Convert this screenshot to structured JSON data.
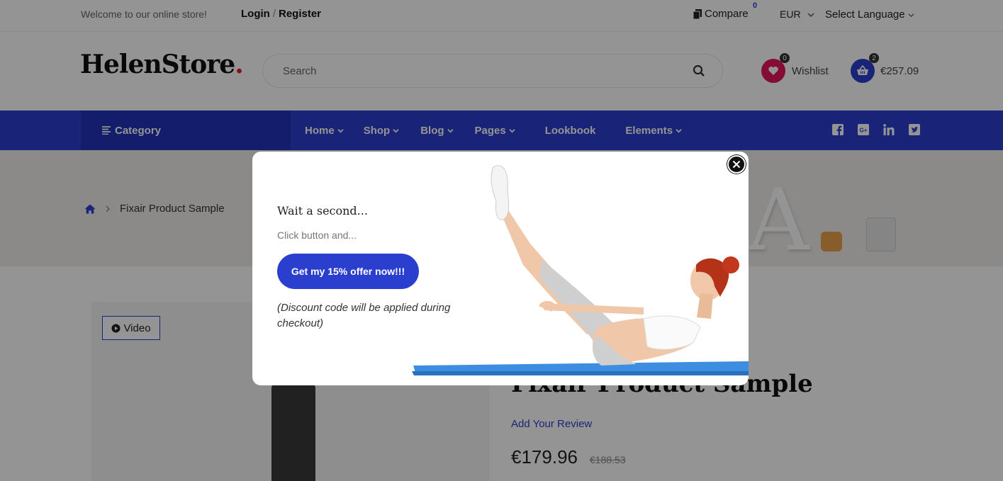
{
  "topbar": {
    "welcome": "Welcome to our online store!",
    "login": "Login",
    "separator": "/",
    "register": "Register",
    "compare_label": "Compare",
    "compare_count": "0",
    "currency": "EUR",
    "language": "Select Language"
  },
  "header": {
    "logo": "HelenStore",
    "logo_dot": ".",
    "search_placeholder": "Search",
    "wishlist_label": "Wishlist",
    "wishlist_count": "0",
    "cart_total": "€257.09",
    "cart_count": "2"
  },
  "nav": {
    "category": "Category",
    "items": [
      {
        "label": "Home",
        "dropdown": true
      },
      {
        "label": "Shop",
        "dropdown": true
      },
      {
        "label": "Blog",
        "dropdown": true
      },
      {
        "label": "Pages",
        "dropdown": true
      },
      {
        "label": "Lookbook",
        "dropdown": false
      },
      {
        "label": "Elements",
        "dropdown": true
      }
    ],
    "social": [
      "facebook-icon",
      "google-plus-icon",
      "linkedin-icon",
      "twitter-icon"
    ]
  },
  "breadcrumb": {
    "current": "Fixair Product Sample"
  },
  "product": {
    "video_label": "Video",
    "title": "Fixair Product Sample",
    "review_link": "Add Your Review",
    "price": "€179.96",
    "old_price": "€188.53"
  },
  "popup": {
    "title": "Wait a second...",
    "subtitle": "Click button and...",
    "cta": "Get my 15% offer now!!!",
    "note": "(Discount code will be applied during checkout)"
  },
  "colors": {
    "primary": "#2b3fcf",
    "wishlist": "#e3155c",
    "logo_dot": "#e02020"
  }
}
